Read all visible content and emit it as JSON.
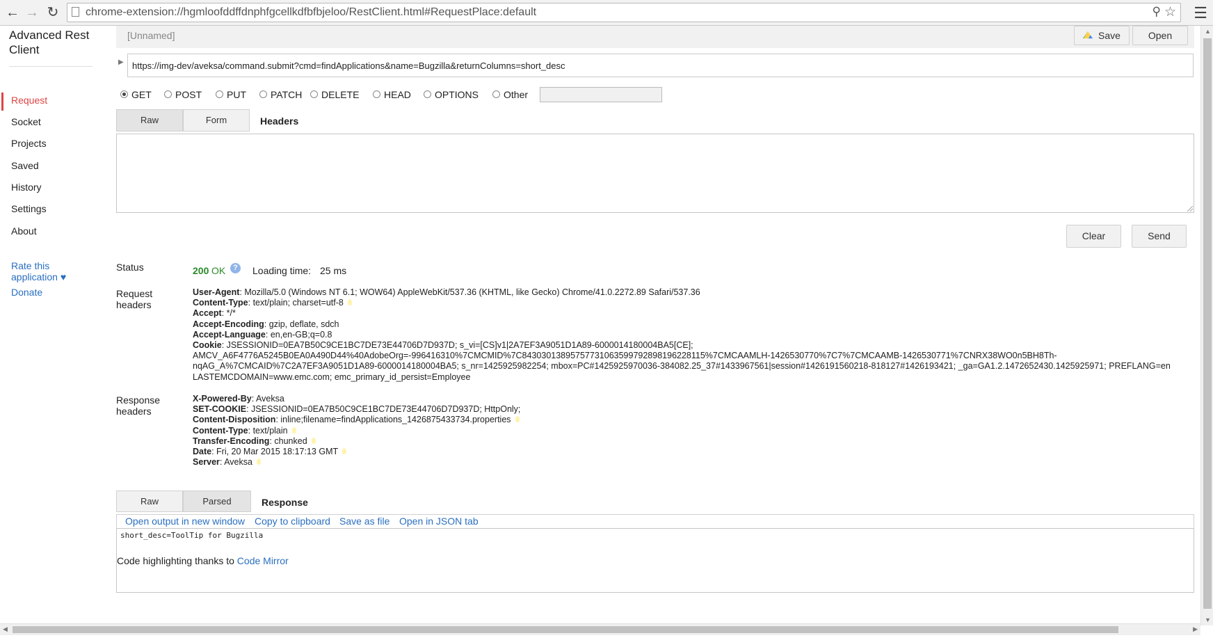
{
  "browser": {
    "url": "chrome-extension://hgmloofddffdnphfgcellkdfbfbjeloo/RestClient.html#RequestPlace:default"
  },
  "sidebar": {
    "title": "Advanced Rest Client",
    "items": [
      {
        "label": "Request",
        "active": true
      },
      {
        "label": "Socket"
      },
      {
        "label": "Projects"
      },
      {
        "label": "Saved"
      },
      {
        "label": "History"
      },
      {
        "label": "Settings"
      },
      {
        "label": "About"
      }
    ],
    "rate_link": "Rate this application ♥",
    "donate_link": "Donate"
  },
  "topbar": {
    "name_placeholder": "[Unnamed]",
    "save_label": "Save",
    "open_label": "Open"
  },
  "request": {
    "url": "https://img-dev/aveksa/command.submit?cmd=findApplications&name=Bugzilla&returnColumns=short_desc",
    "methods": [
      "GET",
      "POST",
      "PUT",
      "PATCH",
      "DELETE",
      "HEAD",
      "OPTIONS",
      "Other"
    ],
    "selected_method": "GET",
    "tabs": [
      "Raw",
      "Form"
    ],
    "headers_title": "Headers",
    "headers_value": "",
    "clear_label": "Clear",
    "send_label": "Send"
  },
  "response": {
    "status_label": "Status",
    "status_code": "200",
    "status_text": "OK",
    "loading_label": "Loading time:",
    "loading_value": "25 ms",
    "request_headers_label": "Request headers",
    "request_headers": [
      {
        "name": "User-Agent",
        "value": ": Mozilla/5.0 (Windows NT 6.1; WOW64) AppleWebKit/537.36 (KHTML, like Gecko) Chrome/41.0.2272.89 Safari/537.36"
      },
      {
        "name": "Content-Type",
        "value": ": text/plain; charset=utf-8"
      },
      {
        "name": "Accept",
        "value": ": */*"
      },
      {
        "name": "Accept-Encoding",
        "value": ": gzip, deflate, sdch"
      },
      {
        "name": "Accept-Language",
        "value": ": en,en-GB;q=0.8"
      },
      {
        "name": "Cookie",
        "value": ": JSESSIONID=0EA7B50C9CE1BC7DE73E44706D7D937D; s_vi=[CS]v1|2A7EF3A9051D1A89-6000014180004BA5[CE];"
      }
    ],
    "cookie_cont_1": "AMCV_A6F4776A5245B0EA0A490D44%40AdobeOrg=-996416310%7CMCMID%7C84303013895757731063599792898196228115%7CMCAAMLH-1426530770%7C7%7CMCAAMB-1426530771%7CNRX38WO0n5BH8Th-",
    "cookie_cont_2": "nqAG_A%7CMCAID%7C2A7EF3A9051D1A89-6000014180004BA5; s_nr=1425925982254; mbox=PC#1425925970036-384082.25_37#1433967561|session#1426191560218-818127#1426193421; _ga=GA1.2.1472652430.1425925971; PREFLANG=en",
    "cookie_cont_3": "LASTEMCDOMAIN=www.emc.com; emc_primary_id_persist=Employee",
    "response_headers_label": "Response headers",
    "response_headers": [
      {
        "name": "X-Powered-By",
        "value": ": Aveksa"
      },
      {
        "name": "SET-COOKIE",
        "value": ": JSESSIONID=0EA7B50C9CE1BC7DE73E44706D7D937D; HttpOnly;"
      },
      {
        "name": "Content-Disposition",
        "value": ": inline;filename=findApplications_1426875433734.properties"
      },
      {
        "name": "Content-Type",
        "value": ": text/plain"
      },
      {
        "name": "Transfer-Encoding",
        "value": ": chunked"
      },
      {
        "name": "Date",
        "value": ": Fri, 20 Mar 2015 18:17:13 GMT"
      },
      {
        "name": "Server",
        "value": ": Aveksa"
      }
    ],
    "tabs": [
      "Raw",
      "Parsed"
    ],
    "title": "Response",
    "links": [
      "Open output in new window",
      "Copy to clipboard",
      "Save as file",
      "Open in JSON tab"
    ],
    "body": "short_desc=ToolTip for Bugzilla",
    "credit_prefix": "Code highlighting thanks to ",
    "credit_link": "Code Mirror"
  }
}
